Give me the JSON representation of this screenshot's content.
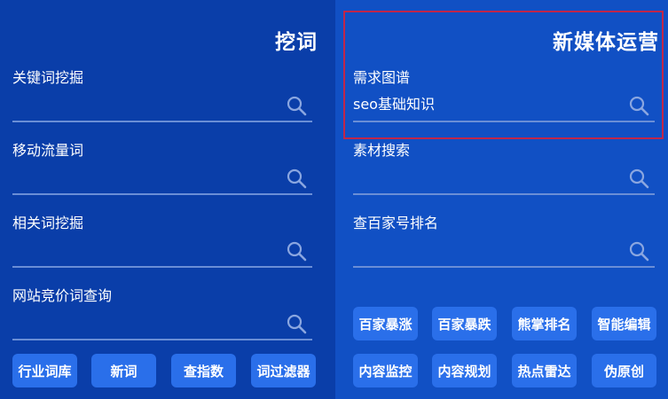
{
  "left": {
    "title": "挖词",
    "fields": [
      {
        "label": "关键词挖掘",
        "value": ""
      },
      {
        "label": "移动流量词",
        "value": ""
      },
      {
        "label": "相关词挖掘",
        "value": ""
      },
      {
        "label": "网站竞价词查询",
        "value": ""
      }
    ],
    "buttons": [
      "行业词库",
      "新词",
      "查指数",
      "词过滤器"
    ]
  },
  "right": {
    "title": "新媒体运营",
    "fields": [
      {
        "label": "需求图谱",
        "value": "seo基础知识"
      },
      {
        "label": "素材搜索",
        "value": ""
      },
      {
        "label": "查百家号排名",
        "value": ""
      }
    ],
    "buttons": [
      "百家暴涨",
      "百家暴跌",
      "熊掌排名",
      "智能编辑",
      "内容监控",
      "内容规划",
      "热点雷达",
      "伪原创"
    ]
  },
  "icons": {
    "search": "search-icon"
  },
  "colors": {
    "left_bg": "#0a3ea9",
    "right_bg": "#1150c4",
    "button_bg": "#2a6fea",
    "highlight_border": "#c0264a"
  }
}
